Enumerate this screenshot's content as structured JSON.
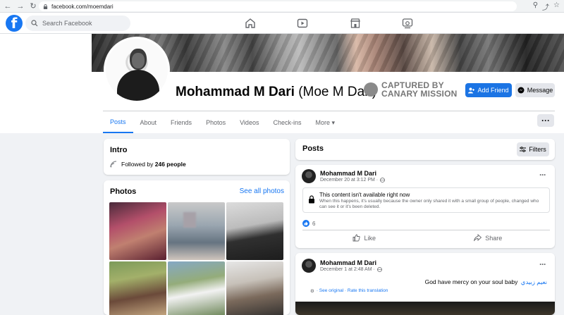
{
  "browser": {
    "url": "facebook.com/moemdari"
  },
  "nav": {
    "logo": "f",
    "search_placeholder": "Search Facebook"
  },
  "profile": {
    "name": "Mohammad M Dari",
    "alt_name": "(Moe M Dari)",
    "stamp_line1": "CAPTURED BY",
    "stamp_line2": "CANARY MISSION",
    "add_friend_label": "Add Friend",
    "message_label": "Message",
    "more_options": "···",
    "tabs": [
      {
        "label": "Posts",
        "active": true
      },
      {
        "label": "About"
      },
      {
        "label": "Friends"
      },
      {
        "label": "Photos"
      },
      {
        "label": "Videos"
      },
      {
        "label": "Check-ins"
      },
      {
        "label": "More ▾"
      }
    ]
  },
  "intro": {
    "title": "Intro",
    "followed_prefix": "Followed by ",
    "followed_count": "246 people"
  },
  "photos": {
    "title": "Photos",
    "see_all": "See all photos"
  },
  "posts": {
    "title": "Posts",
    "filters_label": "Filters",
    "post1": {
      "author": "Mohammad M Dari",
      "date": "December 20 at 3:12 PM ·",
      "unavailable_title": "This content isn't available right now",
      "unavailable_desc": "When this happens, it's usually because the owner only shared it with a small group of people, changed who can see it or it's been deleted.",
      "reaction_count": "6",
      "like_label": "Like",
      "share_label": "Share",
      "dots": "···"
    },
    "post2": {
      "author": "Mohammad M Dari",
      "date": "December 1 at 2:48 AM ·",
      "text": "God have mercy on your soul baby",
      "text_arabic": "نعيم زبيدي",
      "translation": "· See original · Rate this translation",
      "dots": "···"
    }
  },
  "colors": {
    "accent": "#1877f2",
    "background": "#f0f2f5"
  }
}
